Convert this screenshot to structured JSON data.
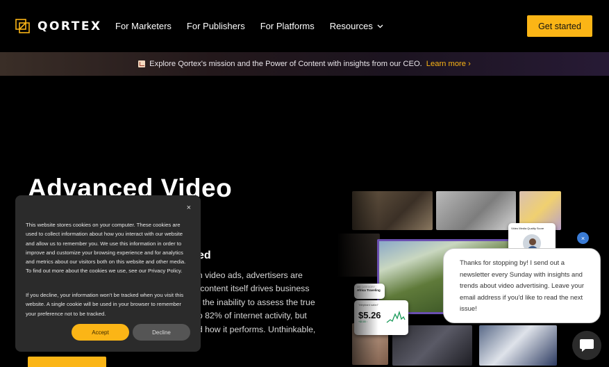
{
  "header": {
    "logo_text": "QORTEX",
    "nav": [
      {
        "label": "For Marketers"
      },
      {
        "label": "For Publishers"
      },
      {
        "label": "For Platforms"
      },
      {
        "label": "Resources",
        "has_dropdown": true
      }
    ],
    "cta_label": "Get started"
  },
  "banner": {
    "text": "Explore Qortex's mission and the Power of Content with insights from our CEO.",
    "link": "Learn more ›"
  },
  "hero": {
    "title": "Advanced Video",
    "subtitle_fragment": "ed",
    "body_lines": [
      "on video ads, advertisers are",
      "e content itself drives business",
      "th the inability to assess the true",
      "up 82% of internet activity, but",
      "nd how it performs. Unthinkable,"
    ]
  },
  "collage": {
    "card_category": "Video Media Quality Score",
    "card_tag": "Africa Traveling",
    "card_tag_label": "IAB CATEGORY",
    "price_label": "\"elephant safari\"",
    "price_value": "$5.26",
    "price_change": "+$0.85 ↑"
  },
  "cookie": {
    "close": "×",
    "p1": "This website stores cookies on your computer. These cookies are used to collect information about how you interact with our website and allow us to remember you. We use this information in order to improve and customize your browsing experience and for analytics and metrics about our visitors both on this website and other media. To find out more about the cookies we use, see our Privacy Policy.",
    "p2": "If you decline, your information won't be tracked when you visit this website. A single cookie will be used in your browser to remember your preference not to be tracked.",
    "accept": "Accept",
    "decline": "Decline"
  },
  "chat": {
    "close": "×",
    "message": "Thanks for stopping by! I send out a newsletter every Sunday with insights and trends about video advertising. Leave your email address if you'd like to read the next issue!"
  },
  "colors": {
    "accent": "#fbb516",
    "background": "#000000",
    "chat_close": "#3a7bd5"
  }
}
